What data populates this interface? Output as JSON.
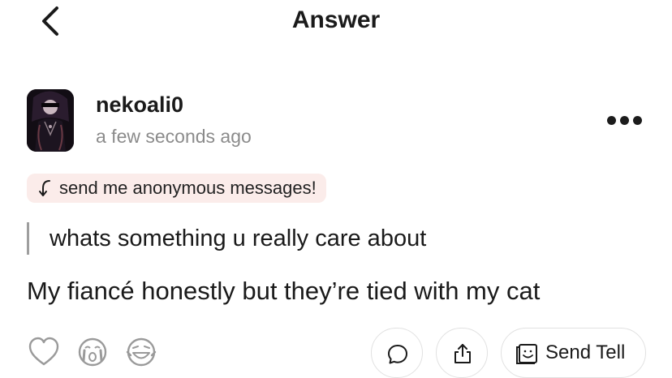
{
  "header": {
    "title": "Answer"
  },
  "post": {
    "username": "nekoali0",
    "timestamp": "a few seconds ago",
    "prompt_chip": "send me anonymous messages!",
    "question": "whats something u really care about",
    "answer": "My fiancé honestly but they’re tied with my cat"
  },
  "actions": {
    "send_tell_label": "Send Tell"
  },
  "icons": {
    "back": "chevron-left-icon",
    "more": "more-horizontal-icon",
    "reply": "reply-arrow-icon",
    "like": "heart-icon",
    "cry": "crying-face-icon",
    "laugh": "laughing-face-icon",
    "comment": "comment-bubble-icon",
    "share": "share-icon",
    "send_tell": "send-tell-icon"
  },
  "colors": {
    "chip_background": "#fbecea",
    "muted_text": "#8b8b8b"
  }
}
